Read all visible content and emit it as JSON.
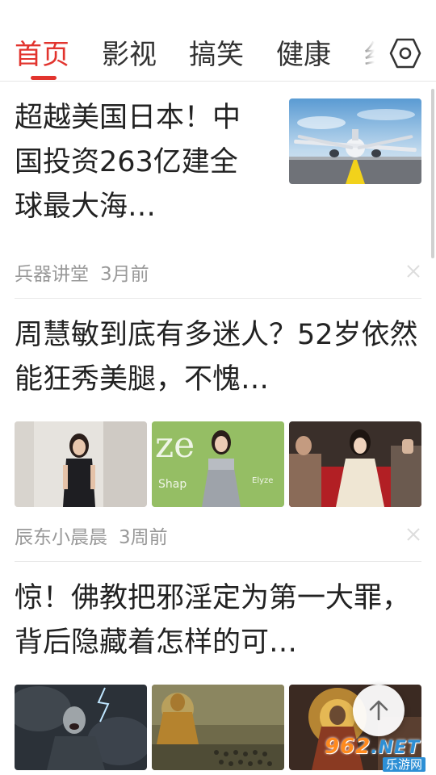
{
  "tabs": [
    {
      "label": "首页",
      "active": true
    },
    {
      "label": "影视",
      "active": false
    },
    {
      "label": "搞笑",
      "active": false
    },
    {
      "label": "健康",
      "active": false
    },
    {
      "label": "纟",
      "active": false
    }
  ],
  "accent_color": "#e2342e",
  "settings_icon": "hexagon-settings-icon",
  "articles": [
    {
      "title": "超越美国日本！中国投资263亿建全球最大海…",
      "source": "兵器讲堂",
      "time": "3月前",
      "image": "airplane-on-runway"
    },
    {
      "title": "周慧敏到底有多迷人？52岁依然能狂秀美腿，不愧…",
      "source": "辰东小晨晨",
      "time": "3周前",
      "images": [
        "woman-in-black-dress",
        "woman-at-event-backdrop",
        "woman-seated-in-theater"
      ]
    },
    {
      "title": "惊！佛教把邪淫定为第一大罪，背后隐藏着怎样的可…",
      "images": [
        "demon-in-smoke",
        "meditating-buddha",
        "monk-with-halo"
      ]
    }
  ],
  "watermark": {
    "brand": "962",
    "suffix": ".NET",
    "sub": "乐游网"
  }
}
